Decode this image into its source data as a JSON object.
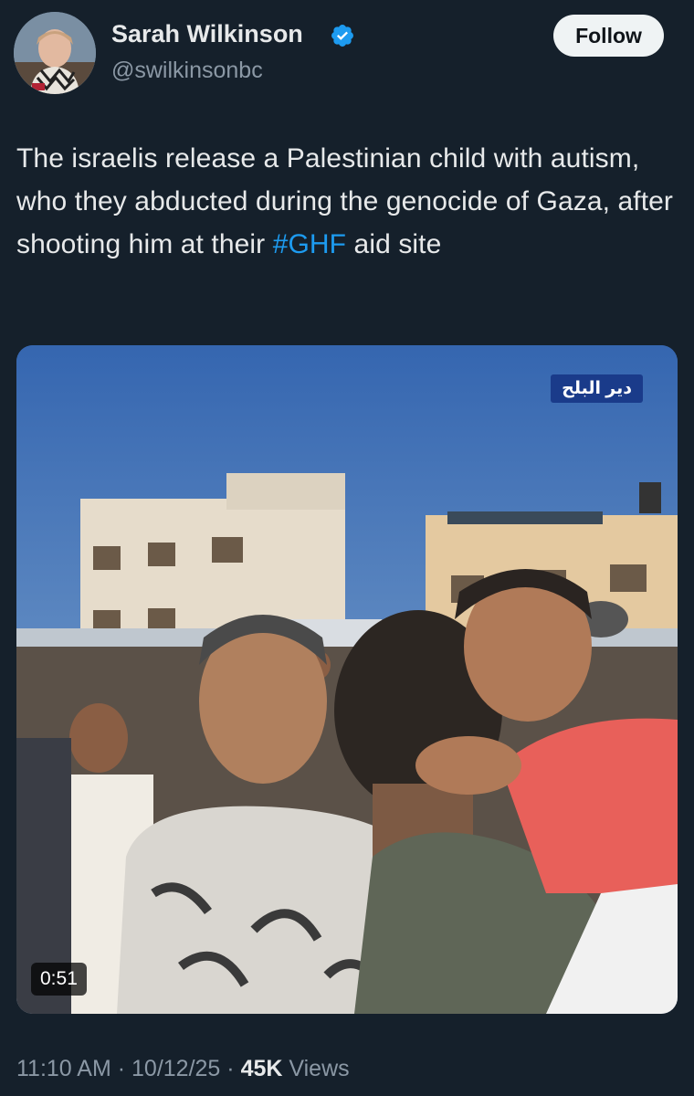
{
  "author": {
    "display_name": "Sarah Wilkinson",
    "handle": "@swilkinsonbc",
    "verified": true
  },
  "follow_button": {
    "label": "Follow"
  },
  "tweet": {
    "text_before_hashtag": "The israelis release a Palestinian child with autism, who they abducted during the genocide of Gaza, after shooting him at their ",
    "hashtag": "#GHF",
    "text_after_hashtag": " aid site"
  },
  "video": {
    "channel_label": "دير البلح",
    "duration": "0:51"
  },
  "meta": {
    "time": "11:10 AM",
    "separator": "·",
    "date": "10/12/25",
    "views_count": "45K",
    "views_label": "Views"
  },
  "colors": {
    "background": "#15202b",
    "link": "#1d9bf0",
    "verified_badge": "#1d9bf0",
    "secondary_text": "#8b98a5"
  }
}
